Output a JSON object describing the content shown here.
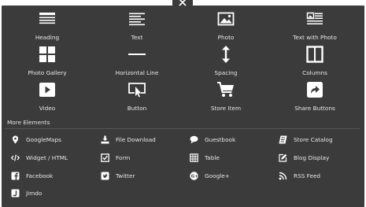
{
  "close_label": "×",
  "tiles": [
    {
      "label": "Heading",
      "icon": "heading-icon"
    },
    {
      "label": "Text",
      "icon": "text-icon"
    },
    {
      "label": "Photo",
      "icon": "photo-icon"
    },
    {
      "label": "Text with Photo",
      "icon": "text-with-photo-icon"
    },
    {
      "label": "Photo Gallery",
      "icon": "photo-gallery-icon"
    },
    {
      "label": "Horizontal Line",
      "icon": "horizontal-line-icon"
    },
    {
      "label": "Spacing",
      "icon": "spacing-icon"
    },
    {
      "label": "Columns",
      "icon": "columns-icon"
    },
    {
      "label": "Video",
      "icon": "video-icon"
    },
    {
      "label": "Button",
      "icon": "button-icon"
    },
    {
      "label": "Store Item",
      "icon": "cart-icon"
    },
    {
      "label": "Share Buttons",
      "icon": "share-icon"
    }
  ],
  "more_elements": {
    "title": "More Elements",
    "items": [
      {
        "label": "GoogleMaps",
        "icon": "map-pin-icon"
      },
      {
        "label": "File Download",
        "icon": "download-icon"
      },
      {
        "label": "Guestbook",
        "icon": "speech-bubble-icon"
      },
      {
        "label": "Store Catalog",
        "icon": "catalog-icon"
      },
      {
        "label": "Widget / HTML",
        "icon": "code-icon"
      },
      {
        "label": "Form",
        "icon": "form-checkbox-icon"
      },
      {
        "label": "Table",
        "icon": "table-icon"
      },
      {
        "label": "Blog Display",
        "icon": "blog-edit-icon"
      },
      {
        "label": "Facebook",
        "icon": "facebook-icon"
      },
      {
        "label": "Twitter",
        "icon": "twitter-icon"
      },
      {
        "label": "Google+",
        "icon": "google-plus-icon"
      },
      {
        "label": "RSS Feed",
        "icon": "rss-icon"
      },
      {
        "label": "Jimdo",
        "icon": "jimdo-icon"
      }
    ]
  },
  "colors": {
    "panel": "#3b3b3b",
    "text": "#e6e6e6",
    "icon": "#ffffff"
  }
}
